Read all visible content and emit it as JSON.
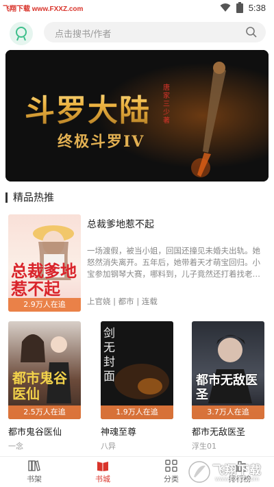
{
  "status_bar": {
    "watermark": "飞翔下载 www.FXXZ.com",
    "time": "5:38"
  },
  "search": {
    "placeholder": "点击搜书/作者"
  },
  "banner": {
    "title": "斗罗大陆",
    "subtitle": "终极斗罗IV",
    "author": "唐家三少著"
  },
  "section": {
    "title": "精品热推"
  },
  "featured": {
    "title": "总裁爹地惹不起",
    "cover_title": "总裁爹地惹不起",
    "badge": "2.9万人在追",
    "description": "一场渡假，被当小姐，回国还撞见未婚夫出轨。她怒然消失离开。五年后，她带着天才萌宝回归。小宝参加钢琴大赛，哪料到，儿子竟然还打着找老…",
    "meta": "上官娆 | 都市 | 连载"
  },
  "books": [
    {
      "name": "都市鬼谷医仙",
      "author": "一念",
      "badge": "2.5万人在追",
      "cover_text": "都市鬼谷医仙"
    },
    {
      "name": "神魂至尊",
      "author": "八异",
      "badge": "1.9万人在追",
      "cover_text": "剑无封面"
    },
    {
      "name": "都市无敌医圣",
      "author": "浮生01",
      "badge": "3.7万人在追",
      "cover_text": "都市无敌医圣"
    }
  ],
  "tabs": [
    {
      "label": "书架",
      "icon": "bookshelf-icon"
    },
    {
      "label": "书城",
      "icon": "bookstore-icon"
    },
    {
      "label": "分类",
      "icon": "category-icon"
    },
    {
      "label": "排行榜",
      "icon": "ranking-icon"
    }
  ],
  "watermark_logo": {
    "text": "飞翔下载",
    "url": "www.FXXZ.com"
  },
  "colors": {
    "accent": "#d9342b",
    "badge": "#e87a3c",
    "banner_gold": "#e3a93a"
  }
}
